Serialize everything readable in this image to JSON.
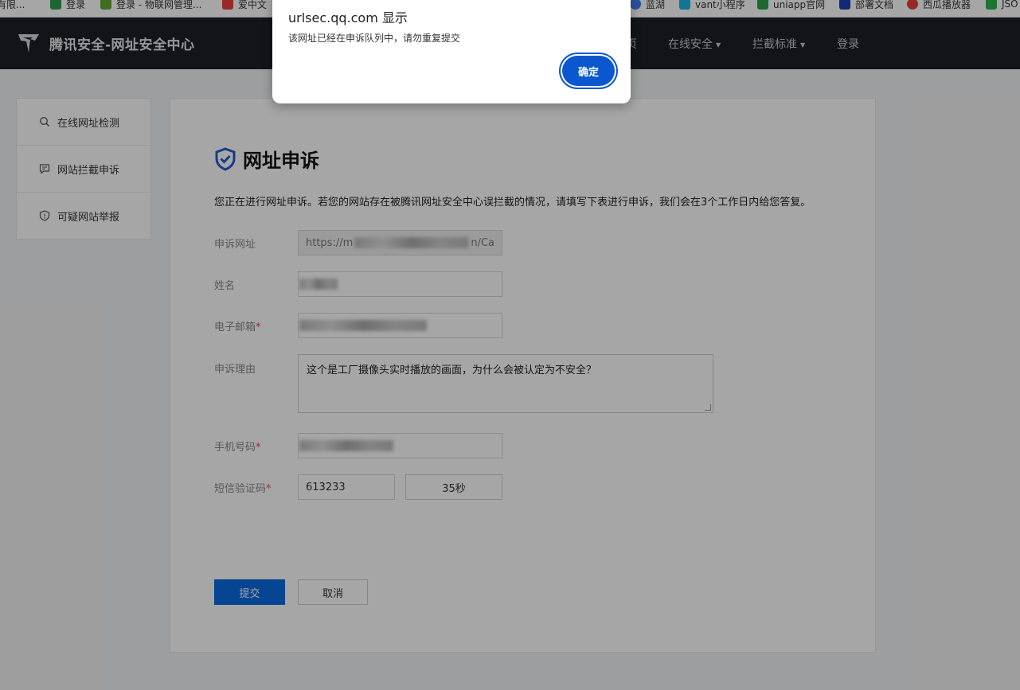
{
  "bookmarks": [
    {
      "label": "有限...",
      "color": "#ffffff"
    },
    {
      "label": "登录",
      "color": "#2e9b4e"
    },
    {
      "label": "登录 - 物联网管理...",
      "color": "#66a832"
    },
    {
      "label": "爱中文",
      "color": "#e8413c"
    },
    {
      "label": "蓝湖",
      "color": "#3f7bf6"
    },
    {
      "label": "vant小程序",
      "color": "#19b6e6"
    },
    {
      "label": "uniapp官网",
      "color": "#2ba245"
    },
    {
      "label": "部署文档",
      "color": "#1d3fb8"
    },
    {
      "label": "西瓜播放器",
      "color": "#e8413c"
    },
    {
      "label": "JSO",
      "color": "#2bb24c"
    }
  ],
  "header": {
    "site_title": "腾讯安全-网址安全中心",
    "nav": [
      {
        "label": "页",
        "caret": ""
      },
      {
        "label": "在线安全",
        "caret": "▼"
      },
      {
        "label": "拦截标准",
        "caret": "▼"
      },
      {
        "label": "登录",
        "caret": ""
      }
    ]
  },
  "sidebar": {
    "items": [
      {
        "label": "在线网址检测",
        "icon": "search-icon"
      },
      {
        "label": "网站拦截申诉",
        "icon": "message-icon"
      },
      {
        "label": "可疑网站举报",
        "icon": "shield-icon"
      }
    ]
  },
  "form": {
    "title": "网址申诉",
    "intro": "您正在进行网址申诉。若您的网站存在被腾讯网址安全中心误拦截的情况，请填写下表进行申诉，我们会在3个工作日内给您答复。",
    "url_label": "申诉网址",
    "url_value_start": "https://m",
    "url_value_end": "n/Ca",
    "name_label": "姓名",
    "email_label": "电子邮箱",
    "reason_label": "申诉理由",
    "reason_value": "这个是工厂摄像头实时播放的画面，为什么会被认定为不安全？",
    "phone_label": "手机号码",
    "sms_label": "短信验证码",
    "sms_value": "613233",
    "countdown": "35秒",
    "required_mark": "*",
    "submit_label": "提交",
    "cancel_label": "取消"
  },
  "dialog": {
    "title": "urlsec.qq.com 显示",
    "message": "该网址已经在申诉队列中，请勿重复提交",
    "ok_label": "确定"
  },
  "colors": {
    "nav_bg": "#1d1f28",
    "primary": "#0a6ae0",
    "dialog_button": "#0b57d0",
    "required": "#e24a4a"
  }
}
